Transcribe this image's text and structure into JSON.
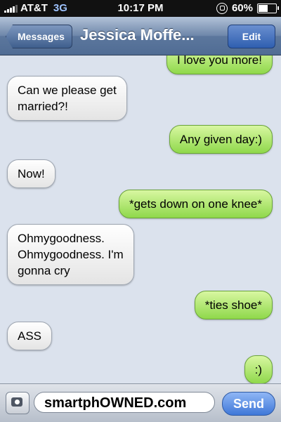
{
  "status_bar": {
    "carrier": "AT&T",
    "network": "3G",
    "time": "10:17 PM",
    "battery": "60%",
    "battery_level": 0.6
  },
  "nav": {
    "back_label": "Messages",
    "title": "Jessica Moffe...",
    "edit_label": "Edit"
  },
  "messages": [
    {
      "direction": "out",
      "text": "I love you more!"
    },
    {
      "direction": "in",
      "text": "Can we please get\nmarried?!"
    },
    {
      "direction": "out",
      "text": "Any given day:)"
    },
    {
      "direction": "in",
      "text": "Now!"
    },
    {
      "direction": "out",
      "text": "*gets down on one knee*"
    },
    {
      "direction": "in",
      "text": "Ohmygoodness.\nOhmygoodness. I'm\ngonna cry"
    },
    {
      "direction": "out",
      "text": "*ties shoe*"
    },
    {
      "direction": "in",
      "text": "ASS"
    },
    {
      "direction": "out",
      "text": ":)"
    }
  ],
  "input_bar": {
    "input_value": "smartphOWNED.com",
    "send_label": "Send"
  }
}
